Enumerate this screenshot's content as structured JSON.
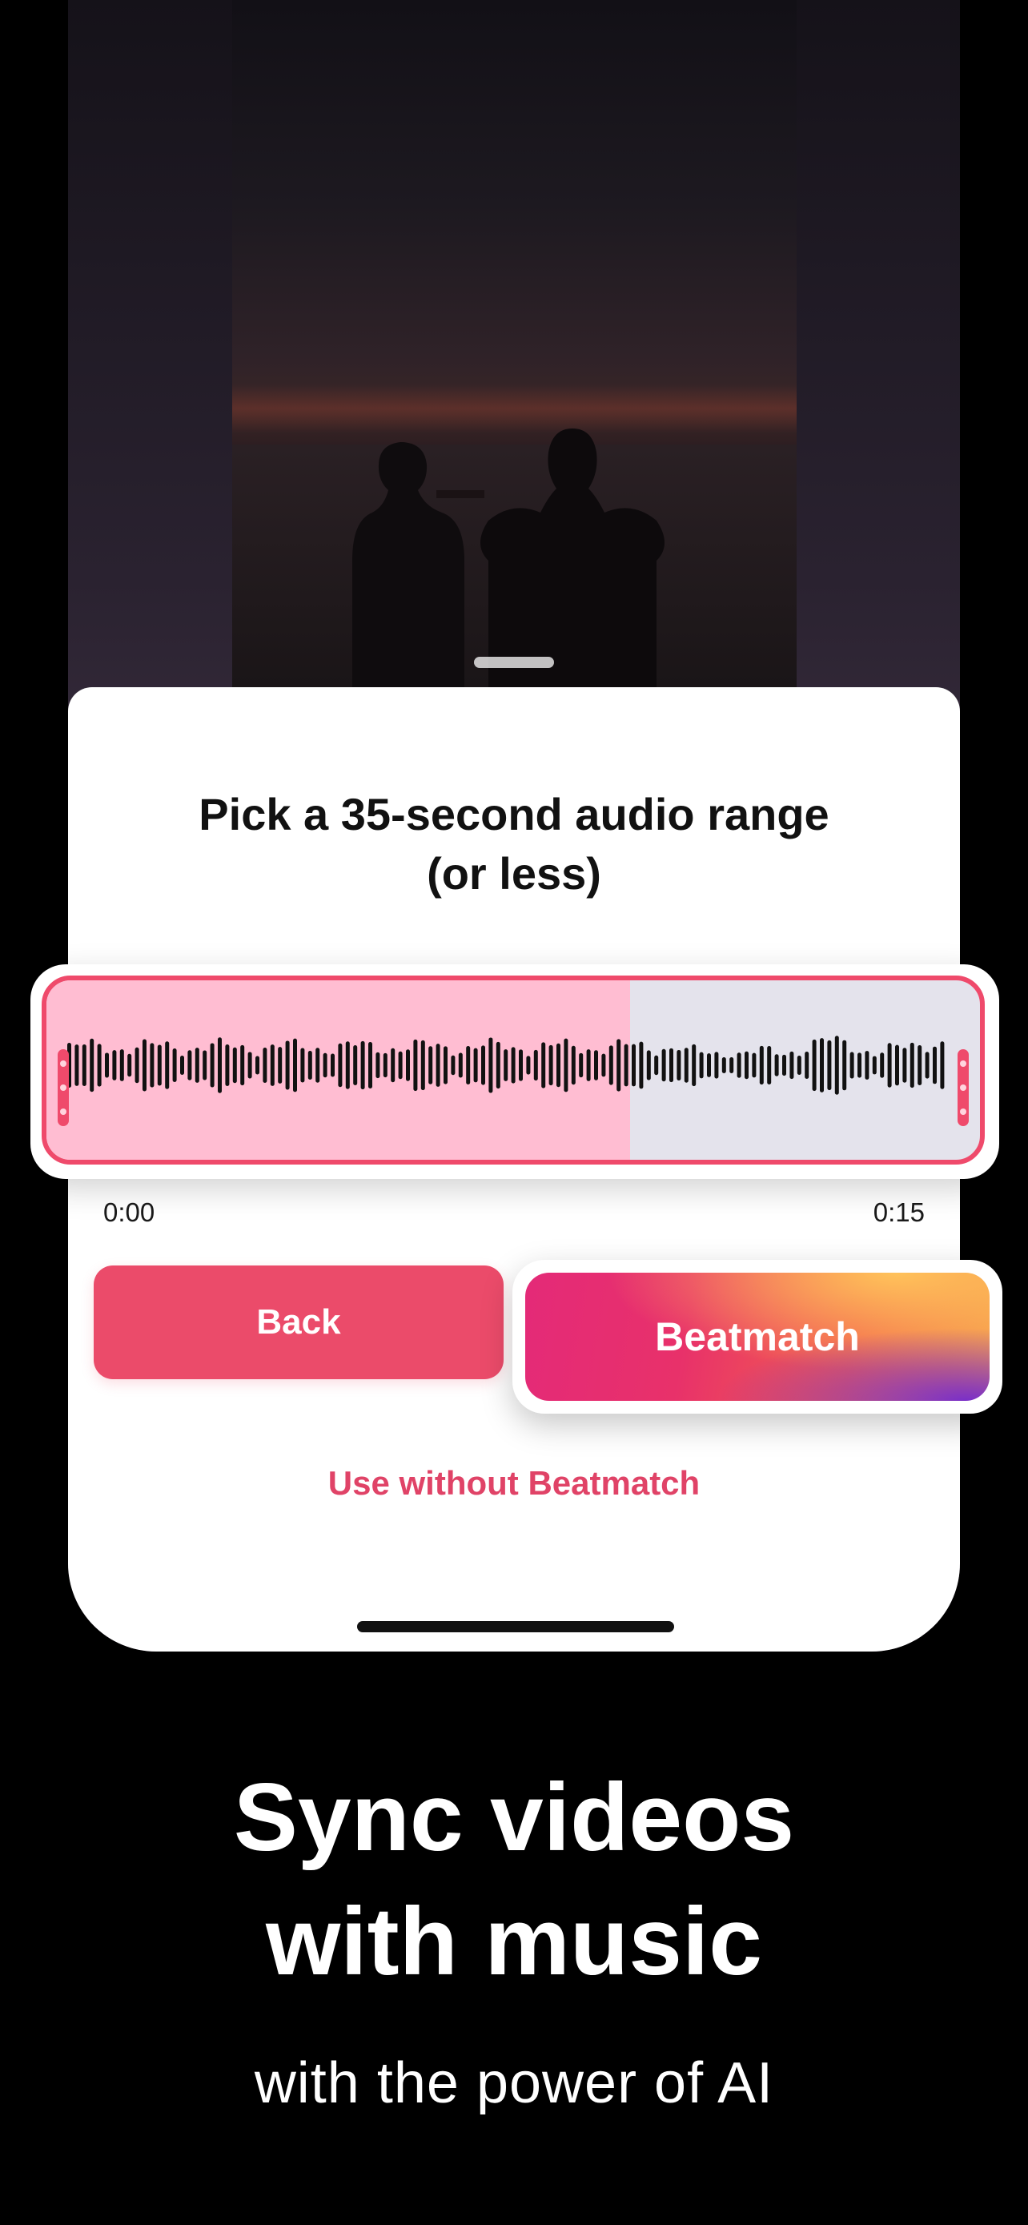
{
  "sheet": {
    "title": "Pick a 35-second audio range\n(or less)",
    "time_start": "0:00",
    "time_end": "0:15",
    "back_label": "Back",
    "beatmatch_label": "Beatmatch",
    "use_without_label": "Use without Beatmatch"
  },
  "waveform": {
    "selected_fraction": 0.625
  },
  "marketing": {
    "headline": "Sync videos\nwith music",
    "subline": "with the power of AI"
  },
  "colors": {
    "accent": "#eb4b6a",
    "selection": "#ffbdd2",
    "unselected": "#e4e3ec"
  }
}
